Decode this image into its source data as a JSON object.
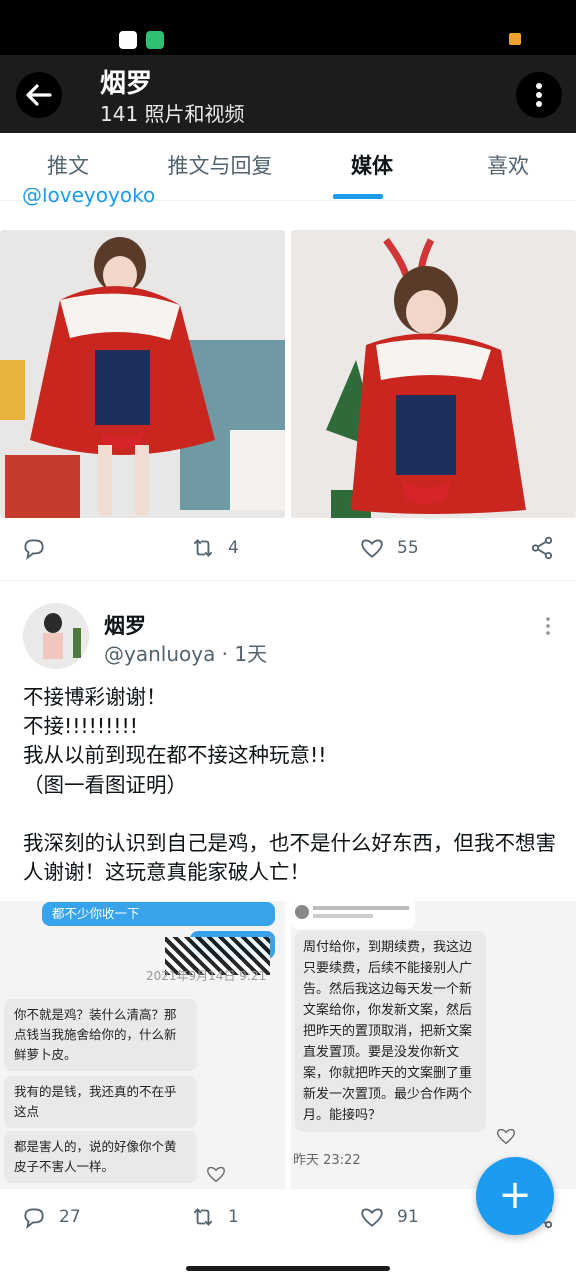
{
  "header": {
    "title": "烟罗",
    "subtitle": "141 照片和视频"
  },
  "tabs": [
    {
      "label": "推文"
    },
    {
      "label": "推文与回复"
    },
    {
      "label": "媒体"
    },
    {
      "label": "喜欢"
    }
  ],
  "first_post": {
    "handle_partial": "@loveyoyoko",
    "retweets": "4",
    "likes": "55"
  },
  "tweet": {
    "name": "烟罗",
    "meta": "@yanluoya · 1天",
    "text": "不接博彩谢谢！\n不接!!!!!!!!!\n我从以前到现在都不接这种玩意!!\n（图一看图证明）\n\n我深刻的认识到自己是鸡，也不是什么好东西，但我不想害人谢谢！这玩意真能家破人亡！",
    "replies": "27",
    "retweets": "1",
    "likes": "91"
  },
  "chat_left": {
    "top_bubble": "都不少你收一下",
    "timestamp": "2021年9月14日 9:21",
    "messages": [
      "你不就是鸡？装什么清高？那点钱当我施舍给你的，什么新鲜萝卜皮。",
      "我有的是钱，我还真的不在乎这点",
      "都是害人的，说的好像你个黄皮子不害人一样。"
    ]
  },
  "chat_right": {
    "message": "周付给你，到期续费，我这边只要续费，后续不能接别人广告。然后我这边每天发一个新文案给你，你发新文案，然后把昨天的置顶取消，把新文案直发置顶。要是没发你新文案，你就把昨天的文案删了重新发一次置顶。最少合作两个月。能接吗？",
    "timestamp": "昨天 23:22"
  },
  "icons": {
    "back": "arrow-left-icon",
    "more": "more-vertical-icon",
    "reply": "reply-icon",
    "retweet": "retweet-icon",
    "like": "heart-icon",
    "share": "share-icon",
    "compose": "plus-icon"
  },
  "colors": {
    "accent": "#1d9bf0",
    "header_bg": "#1c1c1e",
    "muted": "#536471"
  }
}
